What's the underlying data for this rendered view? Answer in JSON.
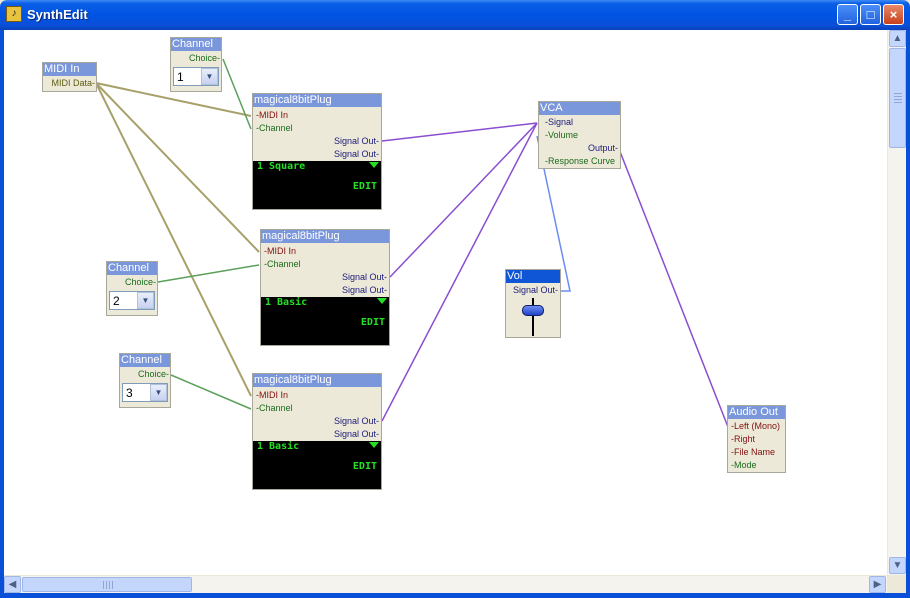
{
  "window": {
    "title": "SynthEdit",
    "minimize": "_",
    "maximize": "□",
    "close": "×",
    "icon": "synthedit-app-icon"
  },
  "modules": {
    "midi_in": {
      "title": "MIDI In",
      "pins": [
        "MIDI Data"
      ]
    },
    "channel1": {
      "title": "Channel",
      "pin": "Choice",
      "value": "1"
    },
    "channel2": {
      "title": "Channel",
      "pin": "Choice",
      "value": "2"
    },
    "channel3": {
      "title": "Channel",
      "pin": "Choice",
      "value": "3"
    },
    "plug1": {
      "title": "magical8bitPlug",
      "in_pins": [
        "MIDI In",
        "Channel"
      ],
      "out_pins": [
        "Signal Out",
        "Signal Out"
      ],
      "lcd_text": "1 Square",
      "edit": "EDIT"
    },
    "plug2": {
      "title": "magical8bitPlug",
      "in_pins": [
        "MIDI In",
        "Channel"
      ],
      "out_pins": [
        "Signal Out",
        "Signal Out"
      ],
      "lcd_text": "1 Basic",
      "edit": "EDIT"
    },
    "plug3": {
      "title": "magical8bitPlug",
      "in_pins": [
        "MIDI In",
        "Channel"
      ],
      "out_pins": [
        "Signal Out",
        "Signal Out"
      ],
      "lcd_text": "1 Basic",
      "edit": "EDIT"
    },
    "vca": {
      "title": "VCA",
      "in_pins": [
        "Signal",
        "Volume"
      ],
      "out_pin": "Output",
      "extra_pin": "Response Curve"
    },
    "vol": {
      "title": "Vol",
      "pin": "Signal Out"
    },
    "audio_out": {
      "title": "Audio Out",
      "pins": [
        "Left (Mono)",
        "Right",
        "File Name",
        "Mode"
      ]
    }
  },
  "colors": {
    "wire_midi": "#a8a06a",
    "wire_channel": "#5aa05a",
    "wire_audio": "#8a4ed0",
    "wire_volume": "#6a8ef0"
  },
  "scroll": {
    "up": "▲",
    "down": "▼",
    "left": "◀",
    "right": "▶"
  }
}
